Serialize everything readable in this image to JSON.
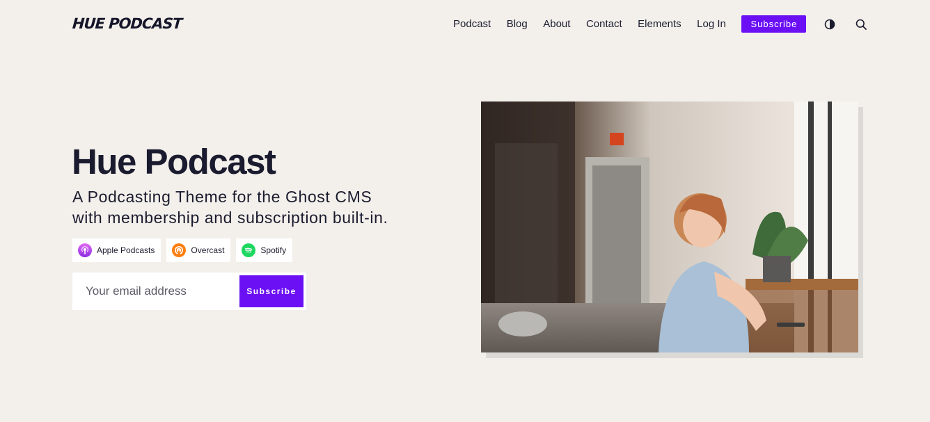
{
  "brand": {
    "logo": "HUE PODCAST",
    "accent": "#6b10f5"
  },
  "nav": {
    "items": [
      "Podcast",
      "Blog",
      "About",
      "Contact",
      "Elements",
      "Log In"
    ],
    "subscribe_label": "Subscribe",
    "icons": [
      "theme-toggle-icon",
      "search-icon"
    ]
  },
  "hero": {
    "title": "Hue Podcast",
    "subtitle": "A Podcasting Theme for the Ghost CMS with membership and subscription built-in.",
    "platforms": [
      {
        "label": "Apple Podcasts",
        "icon": "apple-podcasts-icon"
      },
      {
        "label": "Overcast",
        "icon": "overcast-icon"
      },
      {
        "label": "Spotify",
        "icon": "spotify-icon"
      }
    ],
    "form": {
      "email_placeholder": "Your email address",
      "button_label": "Subscribe"
    }
  }
}
